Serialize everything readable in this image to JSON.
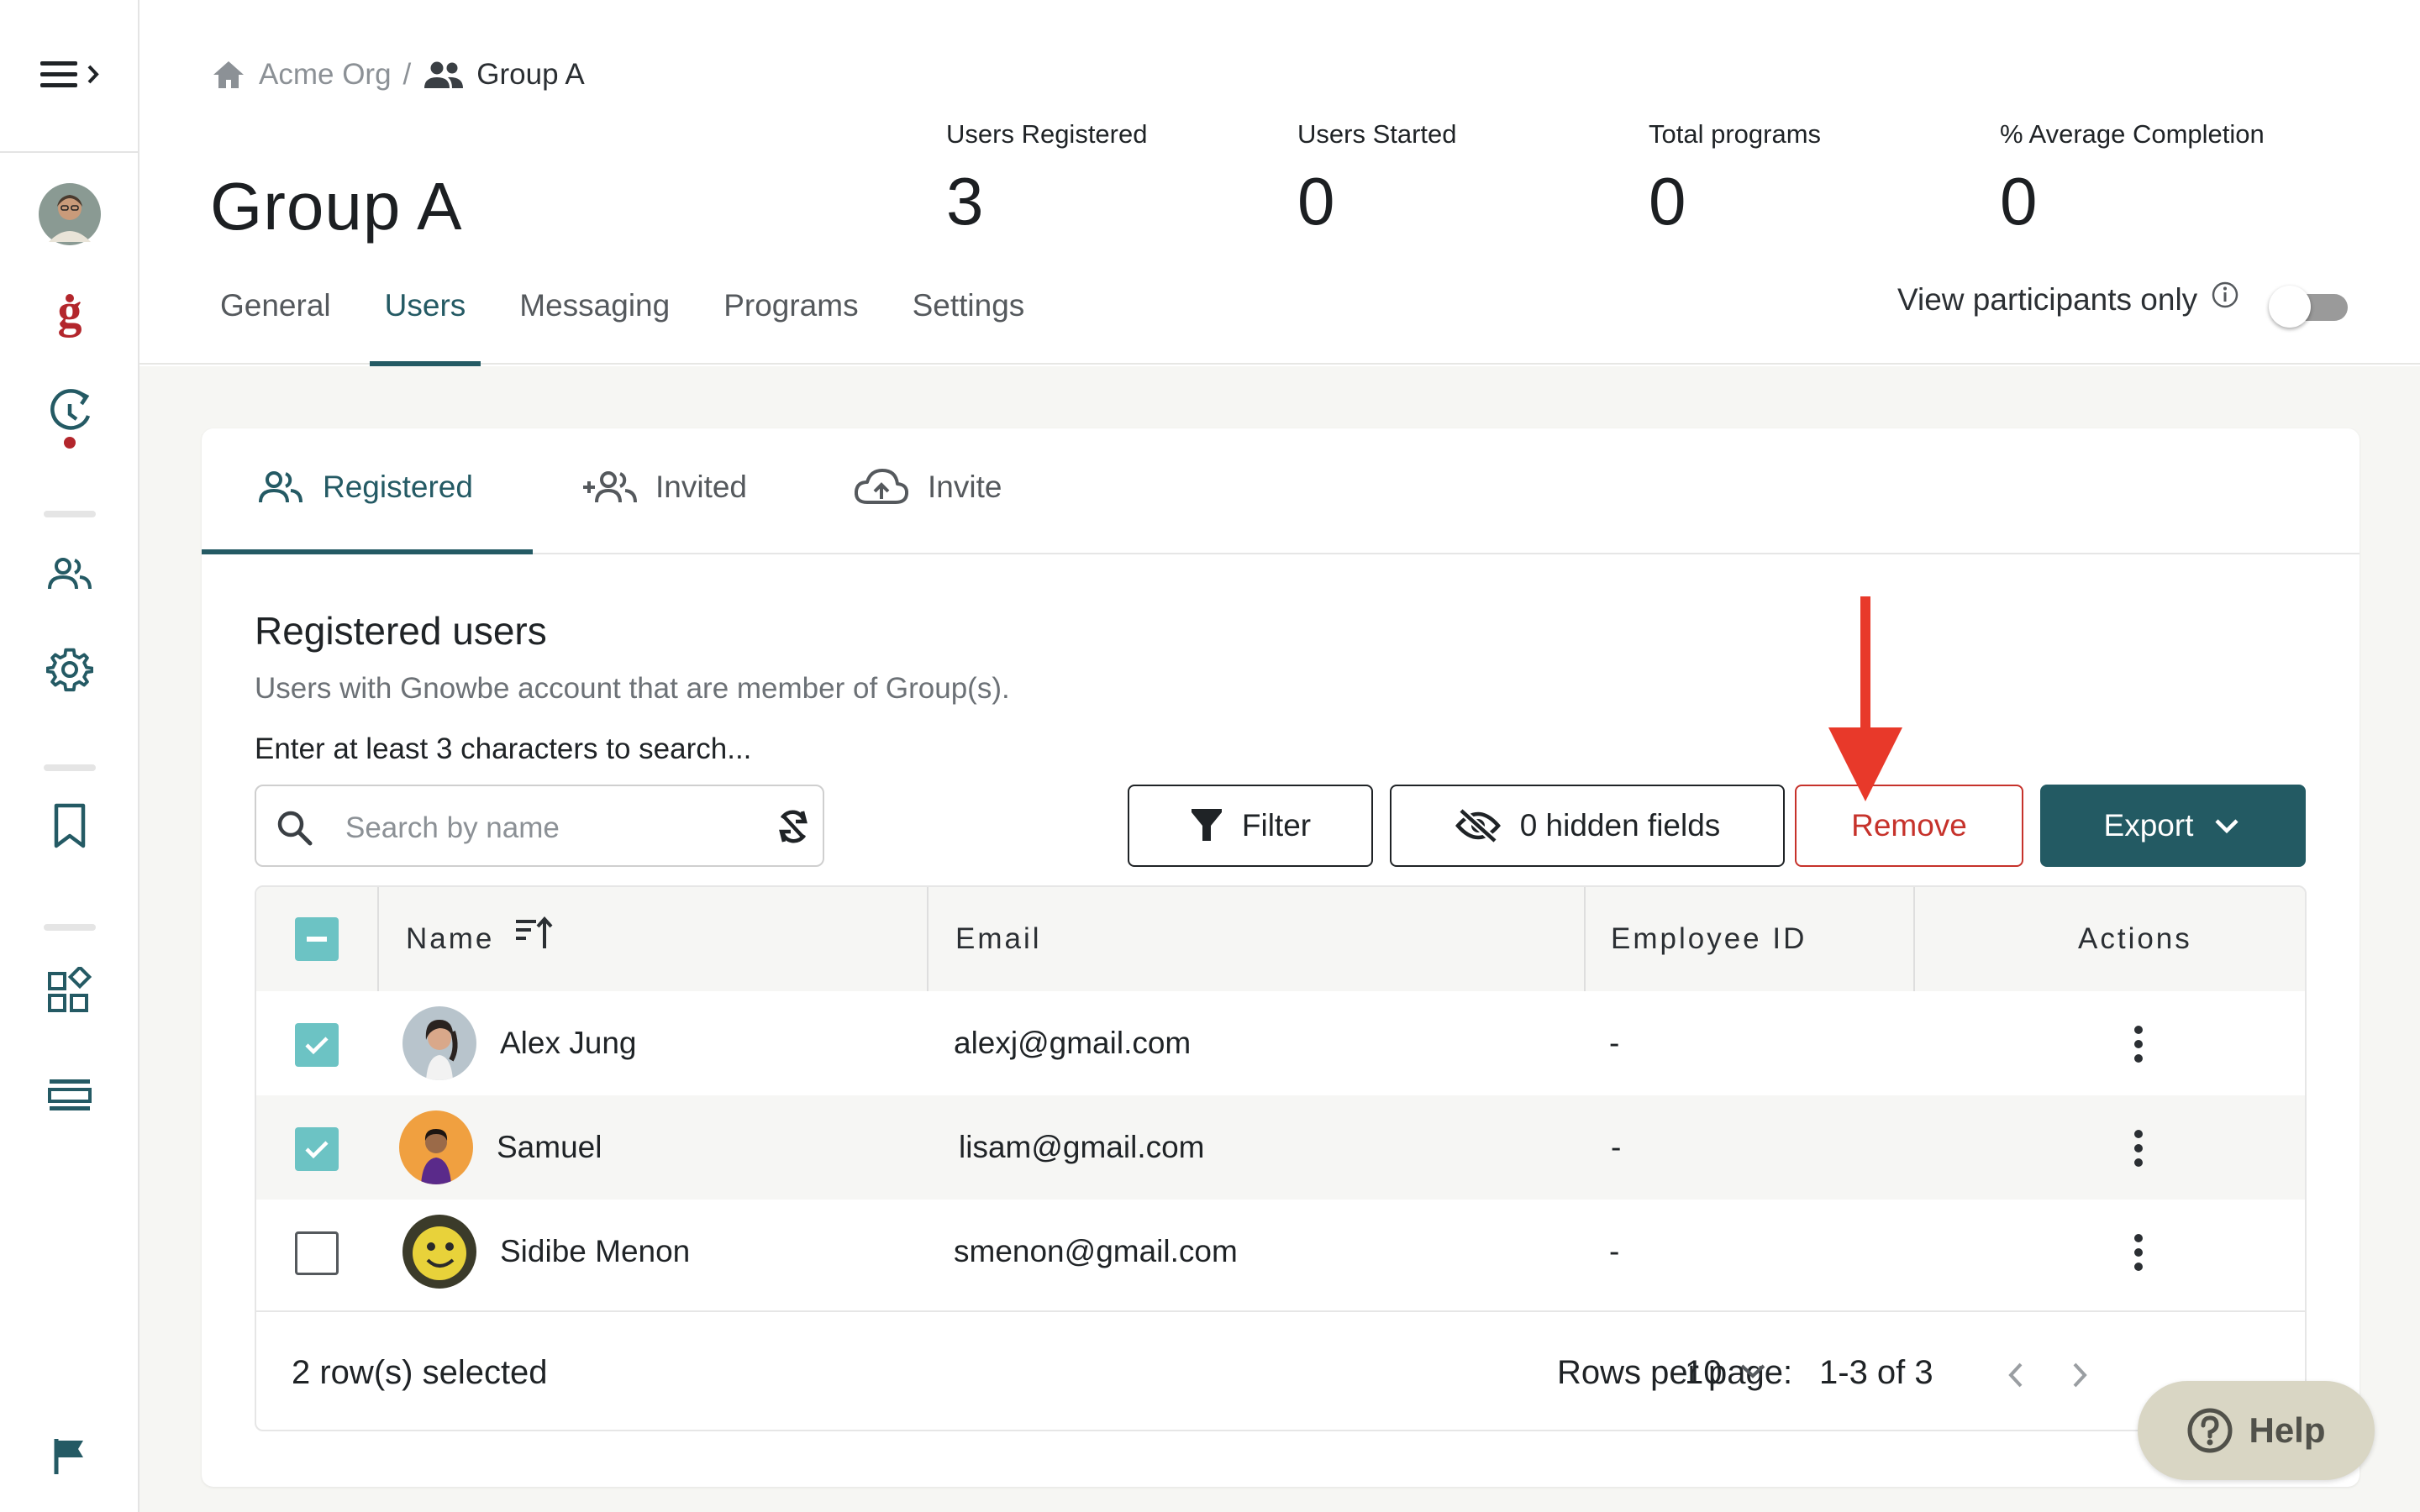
{
  "breadcrumb": {
    "root": "Acme Org",
    "separator": "/",
    "current": "Group A"
  },
  "page": {
    "title": "Group A"
  },
  "stats": [
    {
      "label": "Users Registered",
      "value": "3"
    },
    {
      "label": "Users Started",
      "value": "0"
    },
    {
      "label": "Total programs",
      "value": "0"
    },
    {
      "label": "% Average Completion",
      "value": "0"
    }
  ],
  "tabs": [
    {
      "label": "General"
    },
    {
      "label": "Users",
      "active": true
    },
    {
      "label": "Messaging"
    },
    {
      "label": "Programs"
    },
    {
      "label": "Settings"
    }
  ],
  "participants_toggle": {
    "label": "View participants only",
    "on": false
  },
  "subtabs": [
    {
      "label": "Registered",
      "icon": "people-icon",
      "active": true
    },
    {
      "label": "Invited",
      "icon": "add-people-icon"
    },
    {
      "label": "Invite",
      "icon": "cloud-upload-icon"
    }
  ],
  "section": {
    "title": "Registered users",
    "description": "Users with Gnowbe account that are member of Group(s).",
    "hint": "Enter at least 3 characters to search..."
  },
  "search": {
    "placeholder": "Search by name"
  },
  "toolbar": {
    "filter_label": "Filter",
    "hidden_fields_label": "0 hidden fields",
    "remove_label": "Remove",
    "export_label": "Export"
  },
  "table": {
    "columns": [
      "Name",
      "Email",
      "Employee ID",
      "Actions"
    ],
    "rows": [
      {
        "name": "Alex Jung",
        "email": "alexj@gmail.com",
        "employee_id": "-",
        "selected": true
      },
      {
        "name": "Samuel",
        "email": "lisam@gmail.com",
        "employee_id": "-",
        "selected": true
      },
      {
        "name": "Sidibe Menon",
        "email": "smenon@gmail.com",
        "employee_id": "-",
        "selected": false
      }
    ],
    "selection_summary": "2 row(s) selected",
    "rows_per_page_label": "Rows per page:",
    "rows_per_page": "10",
    "range": "1-3 of 3"
  },
  "help": {
    "label": "Help"
  },
  "colors": {
    "accent": "#245a64",
    "checkbox": "#6cc3c4",
    "remove": "#c6322b",
    "annotation_arrow": "#e8392a"
  }
}
